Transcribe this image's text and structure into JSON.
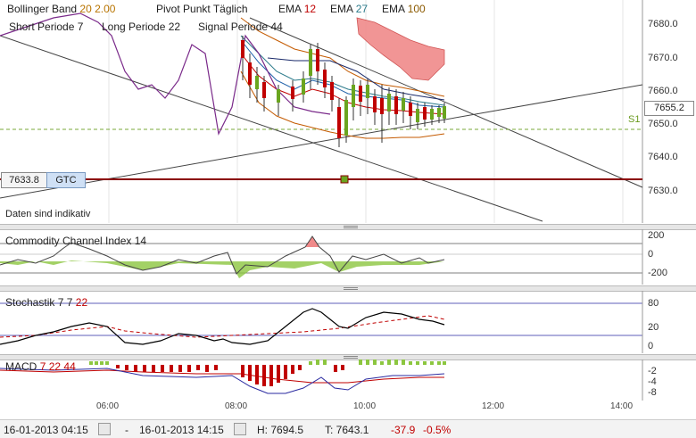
{
  "main": {
    "bollinger": {
      "label": "Bollinger Band",
      "p1": "20",
      "p2": "2.00"
    },
    "pivot": "Pivot Punkt Täglich",
    "ema1": {
      "label": "EMA",
      "value": "12"
    },
    "ema2": {
      "label": "EMA",
      "value": "27"
    },
    "ema3": {
      "label": "EMA",
      "value": "100"
    },
    "short": {
      "label": "Short Periode",
      "value": "7"
    },
    "long": {
      "label": "Long Periode",
      "value": "22"
    },
    "signal": {
      "label": "Signal Periode",
      "value": "44"
    },
    "price_ticks": [
      "7680.0",
      "7670.0",
      "7660.0",
      "7650.0",
      "7640.0",
      "7630.0"
    ],
    "current_price": "7655.2",
    "pivot_label": "S1",
    "order_price": "7633.8",
    "order_type": "GTC",
    "note": "Daten sind indikativ"
  },
  "cci": {
    "label": "Commodity Channel Index",
    "value": "14",
    "ticks": [
      "200",
      "0",
      "-200"
    ]
  },
  "stoch": {
    "label": "Stochastik",
    "p1": "7",
    "p2": "7",
    "p3": "22",
    "ticks": [
      "80",
      "20",
      "0"
    ]
  },
  "macd": {
    "label": "MACD",
    "p1": "7",
    "p2": "22",
    "p3": "44",
    "ticks": [
      "-2",
      "-4",
      "-8"
    ]
  },
  "xaxis": [
    "06:00",
    "08:00",
    "10:00",
    "12:00",
    "14:00"
  ],
  "footer": {
    "from": "16-01-2013 04:15",
    "dash": "-",
    "to": "16-01-2013 14:15",
    "high": "H: 7694.5",
    "low": "T: 7643.1",
    "change": "-37.9",
    "change_pct": "-0.5%"
  },
  "colors": {
    "up": "#6aa51f",
    "down": "#c00000",
    "bb": "#c45a00",
    "stoch_main": "#000000",
    "stoch_signal": "#c00000"
  }
}
